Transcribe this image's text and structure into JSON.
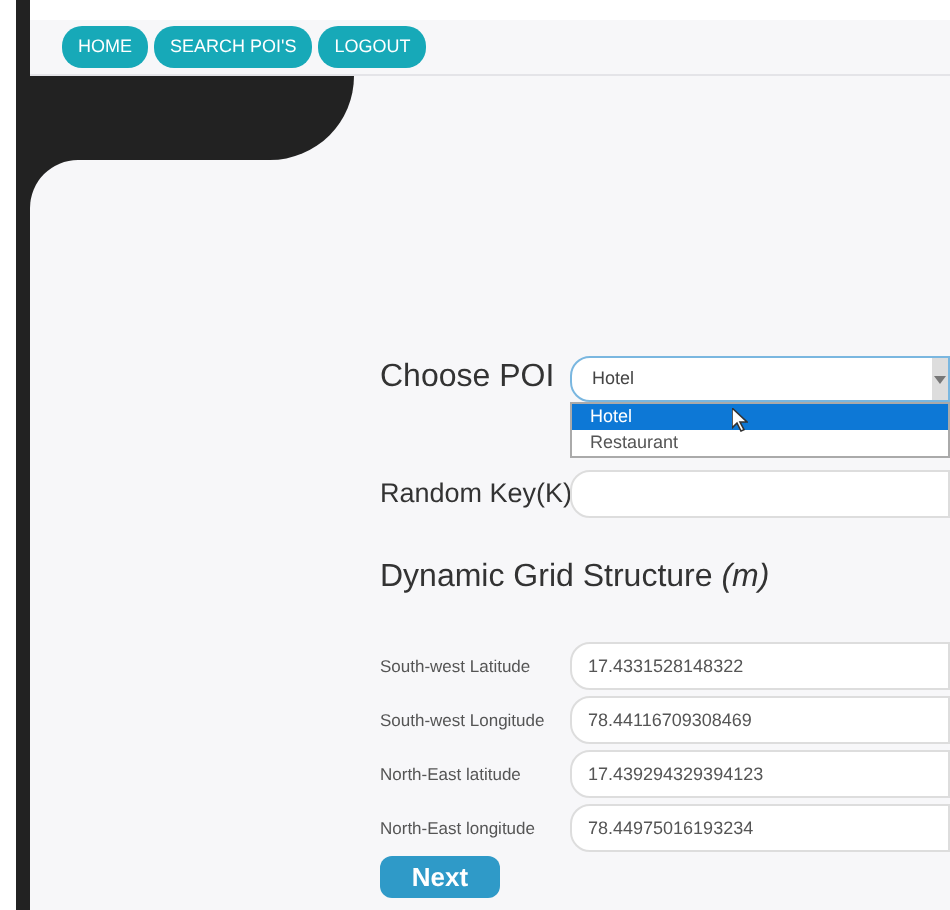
{
  "nav": [
    {
      "label": "HOME"
    },
    {
      "label": "SEARCH POI'S"
    },
    {
      "label": "LOGOUT"
    }
  ],
  "poi": {
    "label": "Choose POI",
    "value": "Hotel",
    "expanded": true,
    "options": [
      {
        "label": "Hotel",
        "selected": true
      },
      {
        "label": "Restaurant",
        "selected": false
      }
    ]
  },
  "random_key": {
    "label": "Random Key(K)"
  },
  "grid": {
    "title": "Dynamic Grid Structure",
    "title_suffix": "(m)",
    "fields": [
      {
        "label": "South-west Latitude",
        "value": "17.4331528148322"
      },
      {
        "label": "South-west Longitude",
        "value": "78.44116709308469"
      },
      {
        "label": "North-East latitude",
        "value": "17.439294329394123"
      },
      {
        "label": "North-East longitude",
        "value": "78.44975016193234"
      }
    ]
  },
  "next_button": "Next"
}
